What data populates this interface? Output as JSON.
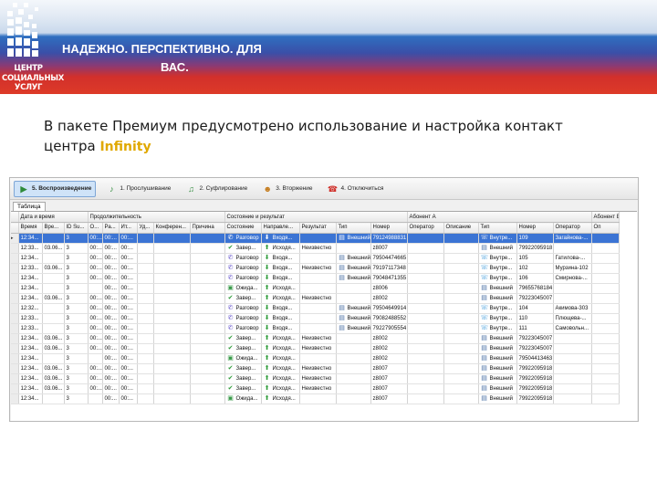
{
  "banner": {
    "logo_lines": [
      "ЦЕНТР",
      "СОЦИАЛЬНЫХ",
      "УСЛУГ"
    ],
    "slogan_line1": "НАДЕЖНО. ПЕРСПЕКТИВНО. ДЛЯ",
    "slogan_line2": "ВАС.",
    "colors": {
      "top": "#dfe8f3",
      "blue": "#2f6fc0",
      "red": "#dd3a28",
      "highlight": "#e0a800"
    }
  },
  "headline": {
    "text_line1": "В пакете Премиум предусмотрено использование и настройка контакт",
    "text_line2_prefix": "центра ",
    "highlight": "Infinity"
  },
  "toolbar": {
    "buttons": [
      {
        "label": "5. Воспроизведение",
        "icon": "play-icon",
        "active": true
      },
      {
        "label": "1. Прослушивание",
        "icon": "music-note-icon",
        "active": false
      },
      {
        "label": "2. Суфлирование",
        "icon": "music-notes-icon",
        "active": false
      },
      {
        "label": "3. Вторжение",
        "icon": "users-icon",
        "active": false
      },
      {
        "label": "4. Отключиться",
        "icon": "hangup-phone-icon",
        "active": false
      }
    ]
  },
  "tab": {
    "label": "Таблица"
  },
  "grid": {
    "groups": [
      {
        "label": "Дата и время",
        "span": 3
      },
      {
        "label": "Продолжительность",
        "span": 6
      },
      {
        "label": "Состояние и результат",
        "span": 5
      },
      {
        "label": "Абонент А",
        "span": 5
      },
      {
        "label": "Абонент Б",
        "span": 5
      }
    ],
    "columns": [
      "Время",
      "Вре...",
      "ID Su...",
      "О...",
      "Ра...",
      "Ит...",
      "Уд...",
      "Конферен...",
      "Причина",
      "Состояние",
      "Направле...",
      "Результат",
      "Тип",
      "Номер",
      "Оператор",
      "Описание",
      "Тип",
      "Номер",
      "Оператор",
      "Оп"
    ],
    "rows": [
      [
        "12:34...",
        "",
        "3",
        "00:...",
        "00:...",
        "00:...",
        "",
        "",
        "",
        "Разговор",
        "Входя...",
        "",
        "Внешний",
        "79124988831",
        "",
        "",
        "Внутре...",
        "109",
        "Загайнова-...",
        ""
      ],
      [
        "12:33...",
        "03.06...",
        "3",
        "00:...",
        "00:...",
        "00:...",
        "",
        "",
        "",
        "Завер...",
        "Исходя...",
        "Неизвестно",
        "",
        "z8007",
        "",
        "",
        "Внешний",
        "79922095918",
        "",
        ""
      ],
      [
        "12:34...",
        "",
        "3",
        "00:...",
        "00:...",
        "00:...",
        "",
        "",
        "",
        "Разговор",
        "Входя...",
        "",
        "Внешний",
        "79504474665",
        "",
        "",
        "Внутре...",
        "105",
        "Гатилова-...",
        ""
      ],
      [
        "12:33...",
        "03.06...",
        "3",
        "00:...",
        "00:...",
        "00:...",
        "",
        "",
        "",
        "Разговор",
        "Входя...",
        "Неизвестно",
        "Внешний",
        "79197117348",
        "",
        "",
        "Внутре...",
        "102",
        "Мурзина-102",
        ""
      ],
      [
        "12:34...",
        "",
        "3",
        "00:...",
        "00:...",
        "00:...",
        "",
        "",
        "",
        "Разговор",
        "Входя...",
        "",
        "Внешний",
        "79048471355",
        "",
        "",
        "Внутре...",
        "106",
        "Смирнова-...",
        ""
      ],
      [
        "12:34...",
        "",
        "3",
        "",
        "00:...",
        "00:...",
        "",
        "",
        "",
        "Ожида...",
        "Исходя...",
        "",
        "",
        "z8006",
        "",
        "",
        "Внешний",
        "79655768184",
        "",
        ""
      ],
      [
        "12:34...",
        "03.06...",
        "3",
        "00:...",
        "00:...",
        "00:...",
        "",
        "",
        "",
        "Завер...",
        "Исходя...",
        "Неизвестно",
        "",
        "z8002",
        "",
        "",
        "Внешний",
        "79223045007",
        "",
        ""
      ],
      [
        "12:32...",
        "",
        "3",
        "00:...",
        "00:...",
        "00:...",
        "",
        "",
        "",
        "Разговор",
        "Входя...",
        "",
        "Внешний",
        "79504649914",
        "",
        "",
        "Внутре...",
        "104",
        "Акимова-303",
        ""
      ],
      [
        "12:33...",
        "",
        "3",
        "00:...",
        "00:...",
        "00:...",
        "",
        "",
        "",
        "Разговор",
        "Входя...",
        "",
        "Внешний",
        "79082488552",
        "",
        "",
        "Внутре...",
        "110",
        "Плющева-...",
        ""
      ],
      [
        "12:33...",
        "",
        "3",
        "00:...",
        "00:...",
        "00:...",
        "",
        "",
        "",
        "Разговор",
        "Входя...",
        "",
        "Внешний",
        "79227905554",
        "",
        "",
        "Внутре...",
        "111",
        "Самовольн...",
        ""
      ],
      [
        "12:34...",
        "03.06...",
        "3",
        "00:...",
        "00:...",
        "00:...",
        "",
        "",
        "",
        "Завер...",
        "Исходя...",
        "Неизвестно",
        "",
        "z8002",
        "",
        "",
        "Внешний",
        "79223045007",
        "",
        ""
      ],
      [
        "12:34...",
        "03.06...",
        "3",
        "00:...",
        "00:...",
        "00:...",
        "",
        "",
        "",
        "Завер...",
        "Исходя...",
        "Неизвестно",
        "",
        "z8002",
        "",
        "",
        "Внешний",
        "79223045007",
        "",
        ""
      ],
      [
        "12:34...",
        "",
        "3",
        "",
        "00:...",
        "00:...",
        "",
        "",
        "",
        "Ожида...",
        "Исходя...",
        "",
        "",
        "z8002",
        "",
        "",
        "Внешний",
        "79504413463",
        "",
        ""
      ],
      [
        "12:34...",
        "03.06...",
        "3",
        "00:...",
        "00:...",
        "00:...",
        "",
        "",
        "",
        "Завер...",
        "Исходя...",
        "Неизвестно",
        "",
        "z8007",
        "",
        "",
        "Внешний",
        "79922095918",
        "",
        ""
      ],
      [
        "12:34...",
        "03.06...",
        "3",
        "00:...",
        "00:...",
        "00:...",
        "",
        "",
        "",
        "Завер...",
        "Исходя...",
        "Неизвестно",
        "",
        "z8007",
        "",
        "",
        "Внешний",
        "79922095918",
        "",
        ""
      ],
      [
        "12:34...",
        "03.06...",
        "3",
        "00:...",
        "00:...",
        "00:...",
        "",
        "",
        "",
        "Завер...",
        "Исходя...",
        "Неизвестно",
        "",
        "z8007",
        "",
        "",
        "Внешний",
        "79922095918",
        "",
        ""
      ],
      [
        "12:34...",
        "",
        "3",
        "",
        "00:...",
        "00:...",
        "",
        "",
        "",
        "Ожида...",
        "Исходя...",
        "",
        "",
        "z8007",
        "",
        "",
        "Внешний",
        "79922095918",
        "",
        ""
      ]
    ],
    "selected_row": 0
  }
}
